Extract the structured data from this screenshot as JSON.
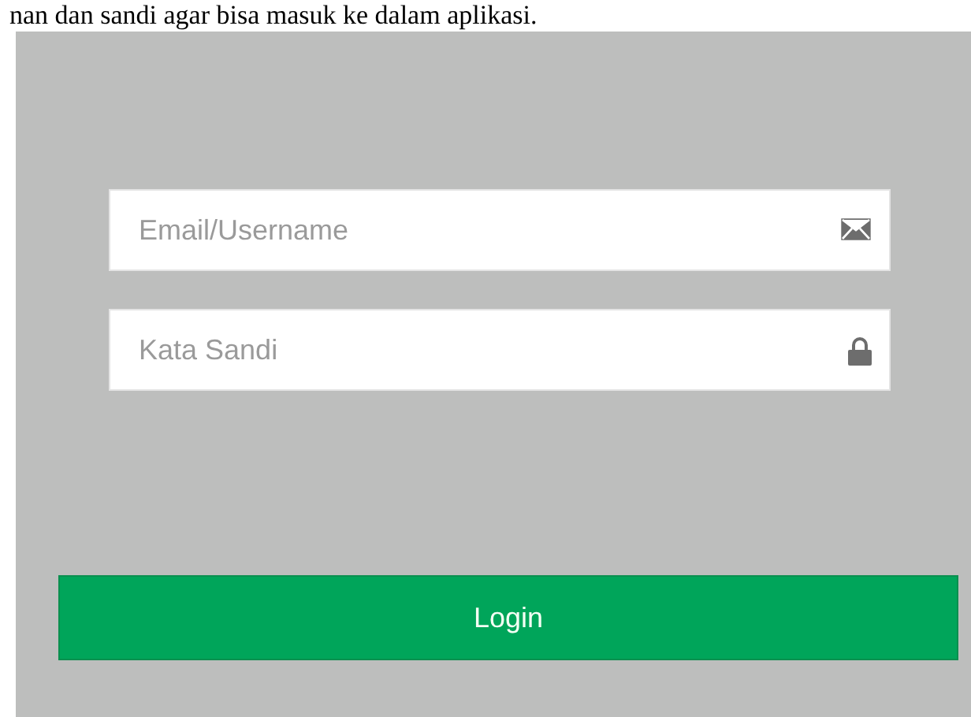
{
  "caption": "nan dan sandi agar bisa masuk ke dalam aplikasi.",
  "fields": [
    {
      "placeholder": "Email/Username",
      "kind": "email"
    },
    {
      "placeholder": "Kata Sandi",
      "kind": "password"
    }
  ],
  "login_button": "Login"
}
